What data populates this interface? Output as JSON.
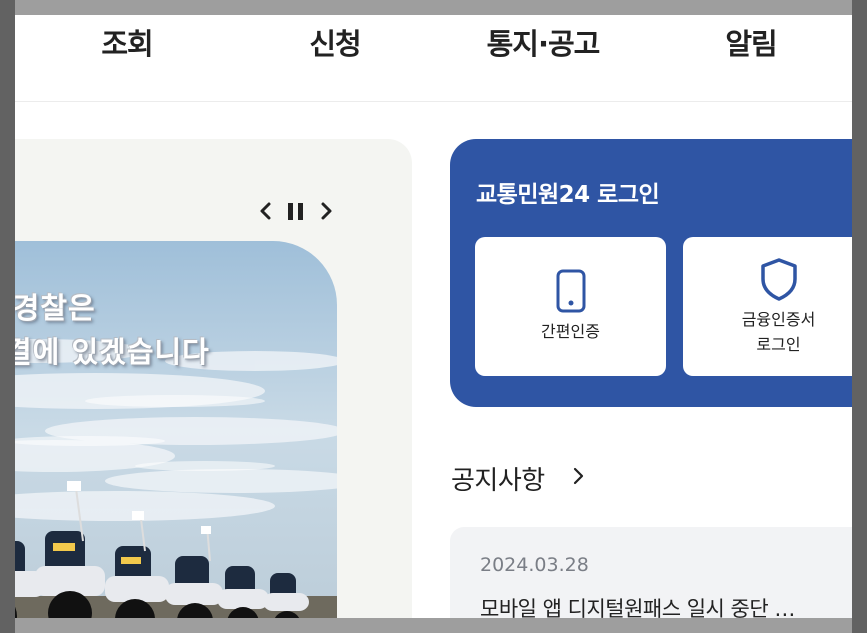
{
  "nav": {
    "items": [
      "조회",
      "신청",
      "통지·공고",
      "알림"
    ]
  },
  "banner": {
    "line1": "통경찰은",
    "line2": "결에 있겠습니다",
    "controls": {
      "prev": "prev-arrow-icon",
      "pause": "pause-icon",
      "next": "next-arrow-icon"
    }
  },
  "login": {
    "title": "교통민원24 로그인",
    "simple_auth_label": "간편인증",
    "cert_label_1": "금융인증서",
    "cert_label_2": "로그인",
    "accent_color": "#2f55a4"
  },
  "notices": {
    "heading": "공지사항",
    "items": [
      {
        "date": "2024.03.28",
        "title": "모바일 앱 디지털원패스 일시 중단 …"
      }
    ]
  }
}
